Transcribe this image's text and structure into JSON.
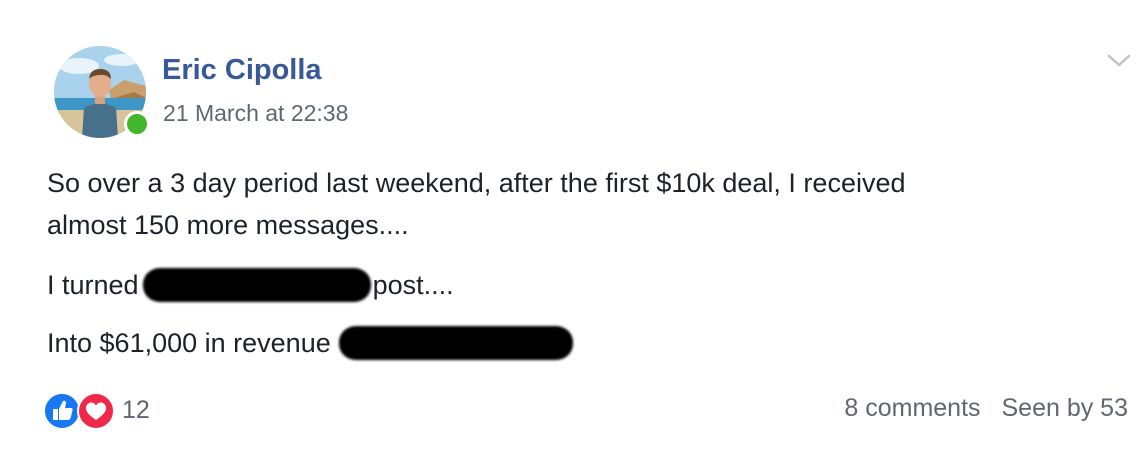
{
  "author": {
    "name": "Eric Cipolla",
    "online": true,
    "avatar_icon": "profile-photo"
  },
  "post": {
    "timestamp": "21 March at 22:38",
    "lines": {
      "line1": "So over a 3 day period last weekend, after the first $10k deal, I received",
      "line2": "almost 150 more messages....",
      "line3_start": "I turned",
      "line3_end": "post....",
      "line4_start": "Into $61,000 in revenue"
    }
  },
  "reactions": {
    "icons": [
      "like-icon",
      "love-icon"
    ],
    "count": "12"
  },
  "stats": {
    "comments": "8 comments",
    "seen": "Seen by 53"
  },
  "colors": {
    "author_name": "#385898",
    "online_dot": "#42b72a",
    "like": "#1877f2",
    "love": "#f0284a",
    "text": "#1d2129",
    "muted": "#616770"
  }
}
